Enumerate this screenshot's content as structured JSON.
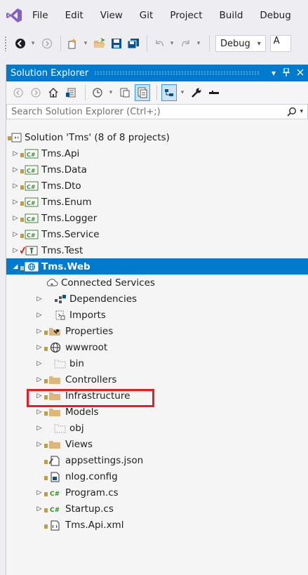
{
  "menubar": {
    "items": [
      "File",
      "Edit",
      "View",
      "Git",
      "Project",
      "Build",
      "Debug"
    ]
  },
  "toolbar": {
    "config_combo": "Debug",
    "platform_combo": "A"
  },
  "solution_explorer": {
    "title": "Solution Explorer",
    "title_pin": "↓",
    "title_close": "✕",
    "search_placeholder": "Search Solution Explorer (Ctrl+;)",
    "search_icon": "search-icon",
    "tree": [
      {
        "label": "Solution 'Tms' (8 of 8 projects)",
        "icon": "solution-icon"
      },
      {
        "label": "Tms.Api",
        "icon": "csharp-project-icon"
      },
      {
        "label": "Tms.Data",
        "icon": "csharp-project-icon"
      },
      {
        "label": "Tms.Dto",
        "icon": "csharp-project-icon"
      },
      {
        "label": "Tms.Enum",
        "icon": "csharp-project-icon"
      },
      {
        "label": "Tms.Logger",
        "icon": "csharp-project-icon"
      },
      {
        "label": "Tms.Service",
        "icon": "csharp-project-icon"
      },
      {
        "label": "Tms.Test",
        "icon": "test-project-icon"
      },
      {
        "label": "Tms.Web",
        "icon": "web-project-icon"
      },
      {
        "label": "Connected Services",
        "icon": "connected-services-icon"
      },
      {
        "label": "Dependencies",
        "icon": "dependencies-icon"
      },
      {
        "label": "Imports",
        "icon": "imports-icon"
      },
      {
        "label": "Properties",
        "icon": "properties-folder-icon"
      },
      {
        "label": "wwwroot",
        "icon": "globe-icon"
      },
      {
        "label": "bin",
        "icon": "excluded-folder-icon"
      },
      {
        "label": "Controllers",
        "icon": "folder-icon"
      },
      {
        "label": "Infrastructure",
        "icon": "folder-icon"
      },
      {
        "label": "Models",
        "icon": "folder-icon"
      },
      {
        "label": "obj",
        "icon": "excluded-folder-icon"
      },
      {
        "label": "Views",
        "icon": "folder-icon"
      },
      {
        "label": "appsettings.json",
        "icon": "json-file-icon"
      },
      {
        "label": "nlog.config",
        "icon": "config-file-icon"
      },
      {
        "label": "Program.cs",
        "icon": "csharp-file-icon"
      },
      {
        "label": "Startup.cs",
        "icon": "csharp-file-icon"
      },
      {
        "label": "Tms.Api.xml",
        "icon": "xml-file-icon"
      }
    ]
  },
  "colors": {
    "accent": "#007acc",
    "vs_purple": "#865fc5",
    "folder": "#dcb67a",
    "highlight_box": "#e31e24",
    "csharp_green": "#388a34",
    "lock_gold": "#c69e2f"
  }
}
